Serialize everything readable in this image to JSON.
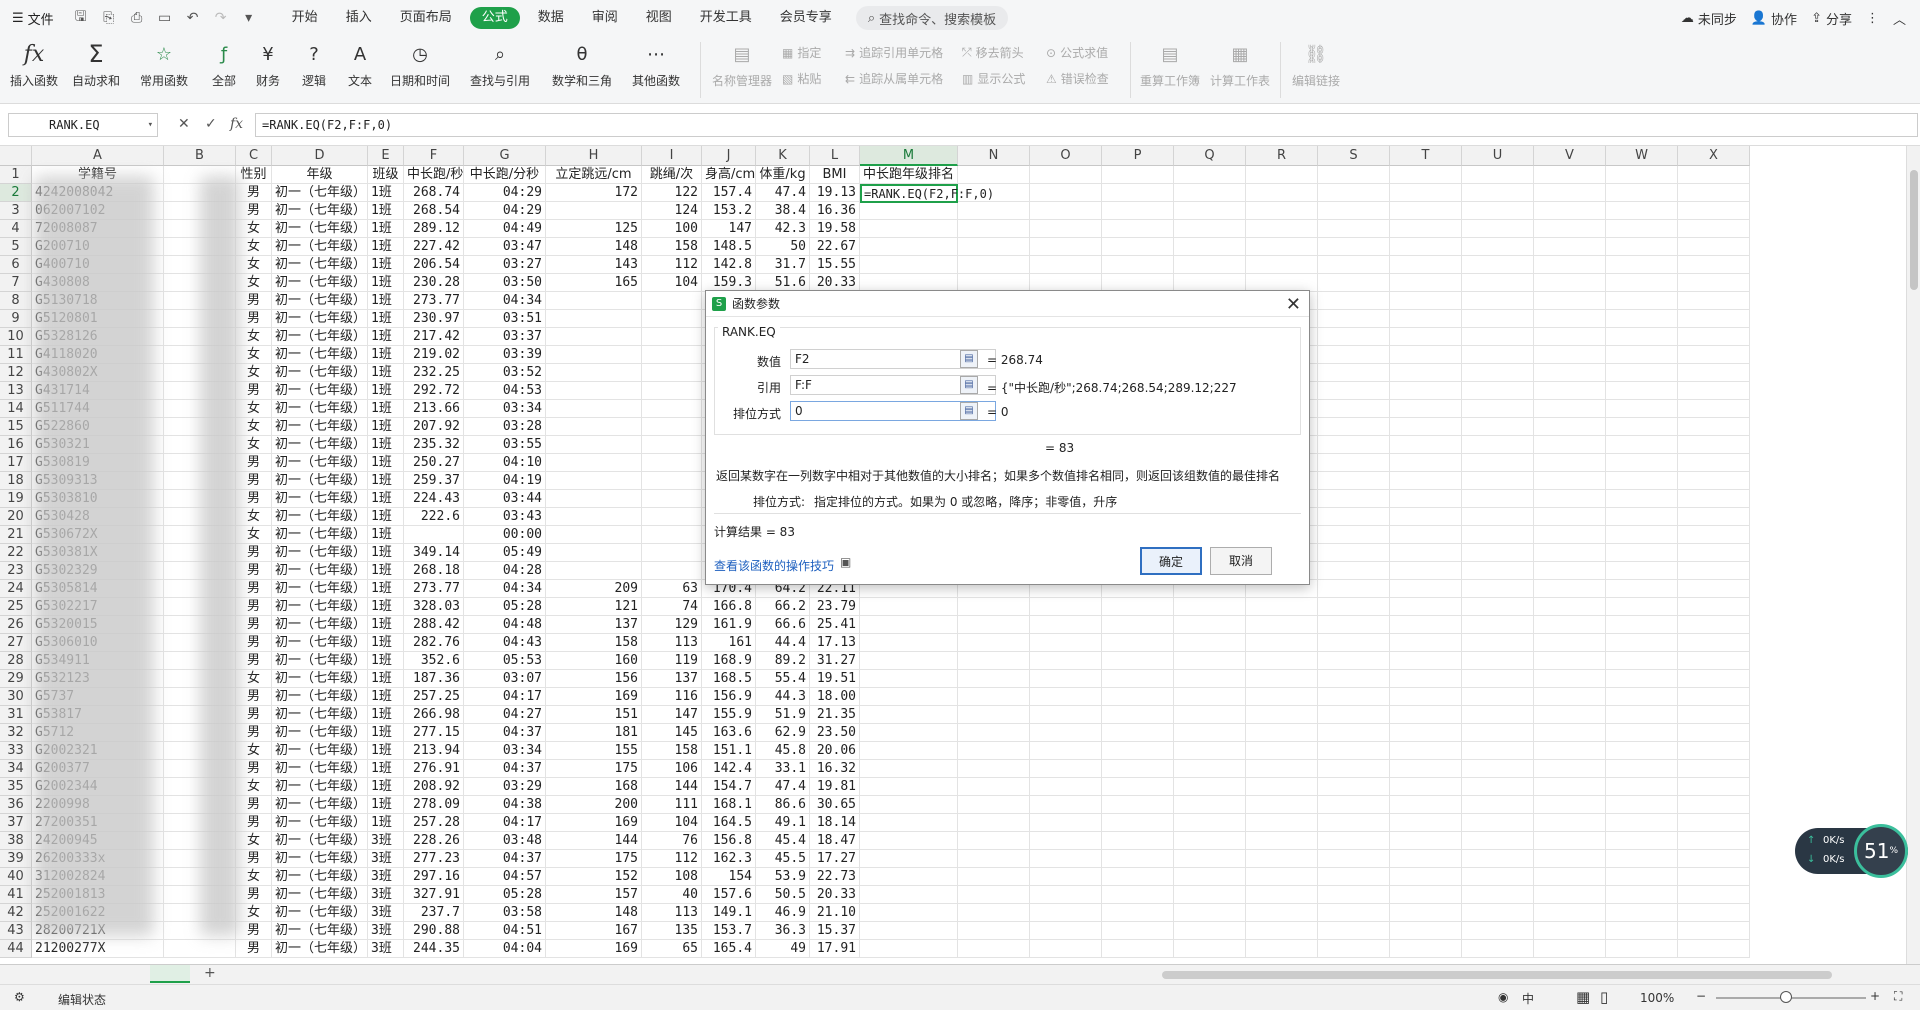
{
  "menubar": {
    "file": "文件",
    "tabs": [
      "开始",
      "插入",
      "页面布局",
      "公式",
      "数据",
      "审阅",
      "视图",
      "开发工具",
      "会员专享"
    ],
    "active_tab": "公式",
    "search_placeholder": "查找命令、搜索模板",
    "right": {
      "sync": "未同步",
      "collab": "协作",
      "share": "分享"
    }
  },
  "ribbon": {
    "buttons": [
      "插入函数",
      "自动求和",
      "常用函数",
      "全部",
      "财务",
      "逻辑",
      "文本",
      "日期和时间",
      "查找与引用",
      "数学和三角",
      "其他函数",
      "名称管理器",
      "粘贴",
      "指定",
      "追踪引用单元格",
      "追踪从属单元格",
      "移去箭头",
      "显示公式",
      "公式求值",
      "错误检查",
      "重算工作簿",
      "计算工作表",
      "编辑链接"
    ]
  },
  "formula_bar": {
    "name_box": "RANK.EQ",
    "formula": "=RANK.EQ(F2,F:F,0)"
  },
  "grid": {
    "columns": [
      "A",
      "B",
      "C",
      "D",
      "E",
      "F",
      "G",
      "H",
      "I",
      "J",
      "K",
      "L",
      "M",
      "N",
      "O",
      "P",
      "Q",
      "R",
      "S",
      "T",
      "U",
      "V",
      "W",
      "X"
    ],
    "header_row": [
      "学籍号",
      "",
      "性别",
      "年级",
      "班级",
      "中长跑/秒",
      "中长跑/分秒",
      "立定跳远/cm",
      "跳绳/次",
      "身高/cm",
      "体重/kg",
      "BMI",
      "中长跑年级排名"
    ],
    "active_cell_edit": "=RANK.EQ(F2,F:F,0)",
    "rows": [
      [
        "2",
        "4242008042",
        "男",
        "初一（七年级）",
        "1班",
        "268.74",
        "04:29",
        "172",
        "122",
        "157.4",
        "47.4",
        "19.13"
      ],
      [
        "3",
        "062007102",
        "男",
        "初一（七年级）",
        "1班",
        "268.54",
        "04:29",
        "",
        "124",
        "153.2",
        "38.4",
        "16.36"
      ],
      [
        "4",
        "72008087",
        "女",
        "初一（七年级）",
        "1班",
        "289.12",
        "04:49",
        "125",
        "100",
        "147",
        "42.3",
        "19.58"
      ],
      [
        "5",
        "G200710",
        "女",
        "初一（七年级）",
        "1班",
        "227.42",
        "03:47",
        "148",
        "158",
        "148.5",
        "50",
        "22.67"
      ],
      [
        "6",
        "G400710",
        "女",
        "初一（七年级）",
        "1班",
        "206.54",
        "03:27",
        "143",
        "112",
        "142.8",
        "31.7",
        "15.55"
      ],
      [
        "7",
        "G430808",
        "女",
        "初一（七年级）",
        "1班",
        "230.28",
        "03:50",
        "165",
        "104",
        "159.3",
        "51.6",
        "20.33"
      ],
      [
        "8",
        "G5130718",
        "男",
        "初一（七年级）",
        "1班",
        "273.77",
        "04:34",
        "",
        "",
        "",
        "",
        ""
      ],
      [
        "9",
        "G5120801",
        "男",
        "初一（七年级）",
        "1班",
        "230.97",
        "03:51",
        "",
        "",
        "",
        "",
        ""
      ],
      [
        "10",
        "G5328126",
        "女",
        "初一（七年级）",
        "1班",
        "217.42",
        "03:37",
        "",
        "",
        "",
        "",
        ""
      ],
      [
        "11",
        "G4118020",
        "女",
        "初一（七年级）",
        "1班",
        "219.02",
        "03:39",
        "",
        "",
        "",
        "",
        ""
      ],
      [
        "12",
        "G430802X",
        "女",
        "初一（七年级）",
        "1班",
        "232.25",
        "03:52",
        "",
        "",
        "",
        "",
        ""
      ],
      [
        "13",
        "G431714",
        "男",
        "初一（七年级）",
        "1班",
        "292.72",
        "04:53",
        "",
        "",
        "",
        "",
        ""
      ],
      [
        "14",
        "G511744",
        "女",
        "初一（七年级）",
        "1班",
        "213.66",
        "03:34",
        "",
        "",
        "",
        "",
        ""
      ],
      [
        "15",
        "G522860",
        "女",
        "初一（七年级）",
        "1班",
        "207.92",
        "03:28",
        "",
        "",
        "",
        "",
        ""
      ],
      [
        "16",
        "G530321",
        "女",
        "初一（七年级）",
        "1班",
        "235.32",
        "03:55",
        "",
        "",
        "",
        "",
        ""
      ],
      [
        "17",
        "G530819",
        "男",
        "初一（七年级）",
        "1班",
        "250.27",
        "04:10",
        "",
        "",
        "",
        "",
        ""
      ],
      [
        "18",
        "G5309313",
        "男",
        "初一（七年级）",
        "1班",
        "259.37",
        "04:19",
        "",
        "",
        "",
        "",
        ""
      ],
      [
        "19",
        "G5303810",
        "男",
        "初一（七年级）",
        "1班",
        "224.43",
        "03:44",
        "",
        "",
        "",
        "",
        ""
      ],
      [
        "20",
        "G530428",
        "女",
        "初一（七年级）",
        "1班",
        "222.6",
        "03:43",
        "",
        "",
        "",
        "",
        ""
      ],
      [
        "21",
        "G530672X",
        "女",
        "初一（七年级）",
        "1班",
        "",
        "00:00",
        "",
        "",
        "",
        "",
        ""
      ],
      [
        "22",
        "G530381X",
        "男",
        "初一（七年级）",
        "1班",
        "349.14",
        "05:49",
        "",
        "",
        "",
        "",
        ""
      ],
      [
        "23",
        "G5302329",
        "男",
        "初一（七年级）",
        "1班",
        "268.18",
        "04:28",
        "",
        "",
        "",
        "",
        ""
      ],
      [
        "24",
        "G5305814",
        "男",
        "初一（七年级）",
        "1班",
        "273.77",
        "04:34",
        "209",
        "63",
        "170.4",
        "64.2",
        "22.11"
      ],
      [
        "25",
        "G5302217",
        "男",
        "初一（七年级）",
        "1班",
        "328.03",
        "05:28",
        "121",
        "74",
        "166.8",
        "66.2",
        "23.79"
      ],
      [
        "26",
        "G5320015",
        "男",
        "初一（七年级）",
        "1班",
        "288.42",
        "04:48",
        "137",
        "129",
        "161.9",
        "66.6",
        "25.41"
      ],
      [
        "27",
        "G5306010",
        "男",
        "初一（七年级）",
        "1班",
        "282.76",
        "04:43",
        "158",
        "113",
        "161",
        "44.4",
        "17.13"
      ],
      [
        "28",
        "G534911",
        "男",
        "初一（七年级）",
        "1班",
        "352.6",
        "05:53",
        "160",
        "119",
        "168.9",
        "89.2",
        "31.27"
      ],
      [
        "29",
        "G532123",
        "女",
        "初一（七年级）",
        "1班",
        "187.36",
        "03:07",
        "156",
        "137",
        "168.5",
        "55.4",
        "19.51"
      ],
      [
        "30",
        "G5737",
        "男",
        "初一（七年级）",
        "1班",
        "257.25",
        "04:17",
        "169",
        "116",
        "156.9",
        "44.3",
        "18.00"
      ],
      [
        "31",
        "G53817",
        "男",
        "初一（七年级）",
        "1班",
        "266.98",
        "04:27",
        "151",
        "147",
        "155.9",
        "51.9",
        "21.35"
      ],
      [
        "32",
        "G5712",
        "男",
        "初一（七年级）",
        "1班",
        "277.15",
        "04:37",
        "181",
        "145",
        "163.6",
        "62.9",
        "23.50"
      ],
      [
        "33",
        "G2002321",
        "女",
        "初一（七年级）",
        "1班",
        "213.94",
        "03:34",
        "155",
        "158",
        "151.1",
        "45.8",
        "20.06"
      ],
      [
        "34",
        "G200377",
        "男",
        "初一（七年级）",
        "1班",
        "276.91",
        "04:37",
        "175",
        "106",
        "142.4",
        "33.1",
        "16.32"
      ],
      [
        "35",
        "G2002344",
        "女",
        "初一（七年级）",
        "1班",
        "208.92",
        "03:29",
        "168",
        "144",
        "154.7",
        "47.4",
        "19.81"
      ],
      [
        "36",
        "2200998",
        "男",
        "初一（七年级）",
        "1班",
        "278.09",
        "04:38",
        "200",
        "111",
        "168.1",
        "86.6",
        "30.65"
      ],
      [
        "37",
        "27200351",
        "男",
        "初一（七年级）",
        "1班",
        "257.28",
        "04:17",
        "169",
        "104",
        "164.5",
        "49.1",
        "18.14"
      ],
      [
        "38",
        "24200945",
        "女",
        "初一（七年级）",
        "3班",
        "228.26",
        "03:48",
        "144",
        "76",
        "156.8",
        "45.4",
        "18.47"
      ],
      [
        "39",
        "26200333x",
        "男",
        "初一（七年级）",
        "3班",
        "277.23",
        "04:37",
        "175",
        "112",
        "162.3",
        "45.5",
        "17.27"
      ],
      [
        "40",
        "312002824",
        "女",
        "初一（七年级）",
        "3班",
        "297.16",
        "04:57",
        "152",
        "108",
        "154",
        "53.9",
        "22.73"
      ],
      [
        "41",
        "252001813",
        "男",
        "初一（七年级）",
        "3班",
        "327.91",
        "05:28",
        "157",
        "40",
        "157.6",
        "50.5",
        "20.33"
      ],
      [
        "42",
        "252001622",
        "女",
        "初一（七年级）",
        "3班",
        "237.7",
        "03:58",
        "148",
        "113",
        "149.1",
        "46.9",
        "21.10"
      ],
      [
        "43",
        "28200721X",
        "男",
        "初一（七年级）",
        "3班",
        "290.88",
        "04:51",
        "167",
        "135",
        "153.7",
        "36.3",
        "15.37"
      ],
      [
        "44",
        "21200277X",
        "男",
        "初一（七年级）",
        "3班",
        "244.35",
        "04:04",
        "169",
        "65",
        "165.4",
        "49",
        "17.91"
      ]
    ]
  },
  "dialog": {
    "title": "函数参数",
    "func_name": "RANK.EQ",
    "args": [
      {
        "label": "数值",
        "value": "F2",
        "result": "= 268.74"
      },
      {
        "label": "引用",
        "value": "F:F",
        "result": "= {\"中长跑/秒\";268.74;268.54;289.12;227...."
      },
      {
        "label": "排位方式",
        "value": "0",
        "result": "= 0"
      }
    ],
    "func_result": "= 83",
    "description": "返回某数字在一列数字中相对于其他数值的大小排名；如果多个数值排名相同，则返回该组数值的最佳排名",
    "arg_help_label": "排位方式:",
    "arg_help": "指定排位的方式。如果为 0 或忽略，降序；非零值，升序",
    "calc_result": "计算结果 = 83",
    "help_link": "查看该函数的操作技巧",
    "ok": "确定",
    "cancel": "取消"
  },
  "statusbar": {
    "mode": "编辑状态",
    "zoom": "100%"
  },
  "net_widget": {
    "up": "0K/s",
    "down": "0K/s",
    "percent": "51"
  }
}
